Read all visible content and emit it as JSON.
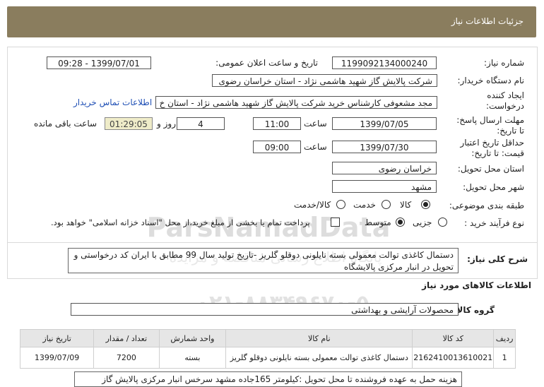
{
  "header": {
    "title": "جزئیات اطلاعات نیاز"
  },
  "form": {
    "need_number_label": "شماره نیاز:",
    "need_number": "1199092134000240",
    "announce_label": "تاریخ و ساعت اعلان عمومی:",
    "announce_value": "1399/07/01 - 09:28",
    "buyer_label": "نام دستگاه خریدار:",
    "buyer_value": "شرکت پالایش گاز شهید هاشمی نژاد - استان خراسان رضوی",
    "creator_label_1": "ایجاد کننده",
    "creator_label_2": "درخواست:",
    "creator_value": "مجد مشعوفی کارشناس خرید شرکت پالایش گاز شهید هاشمی نژاد - استان خ",
    "contact_link": "اطلاعات تماس خریدار",
    "send_deadline_label_1": "مهلت ارسال پاسخ:",
    "send_deadline_label_2": "تا تاریخ:",
    "send_date": "1399/07/05",
    "time_label": "ساعت",
    "send_time": "11:00",
    "days_value": "4",
    "days_label": "روز و",
    "remaining_time": "01:29:05",
    "remaining_label": "ساعت باقی مانده",
    "validity_label_1": "حداقل تاریخ اعتبار",
    "validity_label_2": "قیمت: تا تاریخ:",
    "validity_date": "1399/07/30",
    "validity_time": "09:00",
    "province_label": "استان محل تحویل:",
    "province_value": "خراسان رضوی",
    "city_label": "شهر محل تحویل:",
    "city_value": "مشهد",
    "category_label": "طبقه بندی موضوعی:",
    "category_options": [
      "کالا",
      "خدمت",
      "کالا/خدمت"
    ],
    "category_selected": "کالا",
    "process_label": "نوع فرآیند خرید :",
    "process_options": [
      "جزیی",
      "متوسط"
    ],
    "process_selected": "متوسط",
    "payment_note": "پرداخت تمام یا بخشی از مبلغ خرید،از محل \"اسناد خزانه اسلامی\" خواهد بود."
  },
  "description": {
    "label": "شرح کلی نیاز:",
    "text": "دستمال کاغذی توالت معمولی بسته نایلونی دوقلو گلریز -تاریخ تولید سال 99  مطابق با ایران کد درخواستی و تحویل در انبار مرکزی پالایشگاه"
  },
  "goods_section": {
    "title": "اطلاعات کالاهای مورد نیاز",
    "group_label": "گروه کالا:",
    "group_value": "محصولات آرایشی و بهداشتی"
  },
  "table": {
    "headers": [
      "ردیف",
      "کد کالا",
      "نام کالا",
      "واحد شمارش",
      "تعداد / مقدار",
      "تاریخ نیاز"
    ],
    "rows": [
      [
        "1",
        "2162410013610021",
        "دستمال کاغذی توالت معمولی بسته نایلونی دوقلو گلریز",
        "بسته",
        "7200",
        "1399/07/09"
      ]
    ]
  },
  "footer_note": "هزینه حمل به عهده فروشنده تا محل تحویل :کیلومتر 165جاده مشهد سرخس انبار مرکزی پالایش گاز",
  "watermark": {
    "line1": "ParsNamadData",
    "line2": "پایگاه اطلاع رسانی مناقصه و مزایده",
    "line3": "۰۲۱-۸۸۳۴۹۶۷۰-۵"
  }
}
